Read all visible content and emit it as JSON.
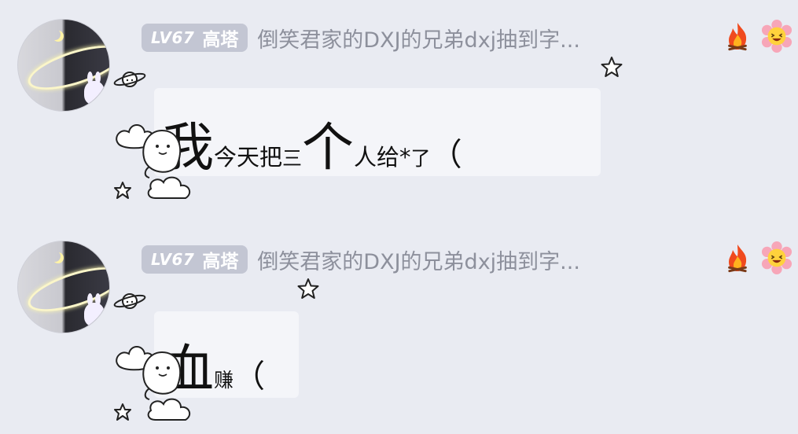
{
  "messages": [
    {
      "level_badge": "LV67",
      "user_name": "高塔",
      "title": "倒笑君家的DXJ的兄弟dxj抽到字...",
      "text_parts": [
        "我",
        "今天把",
        "三",
        "个",
        "人给",
        "*",
        "了",
        "（"
      ],
      "emojis": [
        "fire-emoji",
        "grinning-flower-emoji"
      ]
    },
    {
      "level_badge": "LV67",
      "user_name": "高塔",
      "title": "倒笑君家的DXJ的兄弟dxj抽到字...",
      "text_parts": [
        "血",
        "赚",
        "（"
      ],
      "emojis": [
        "fire-emoji",
        "grinning-flower-emoji"
      ]
    }
  ],
  "colors": {
    "background": "#e9ebf2",
    "bubble": "#f4f5f9",
    "badge": "#c3c6d3",
    "title_text": "#8d909c"
  },
  "icons": [
    "avatar",
    "planet-icon",
    "star-icon",
    "dinosaur-cloud-sticker",
    "fire-emoji",
    "grinning-flower-emoji"
  ]
}
